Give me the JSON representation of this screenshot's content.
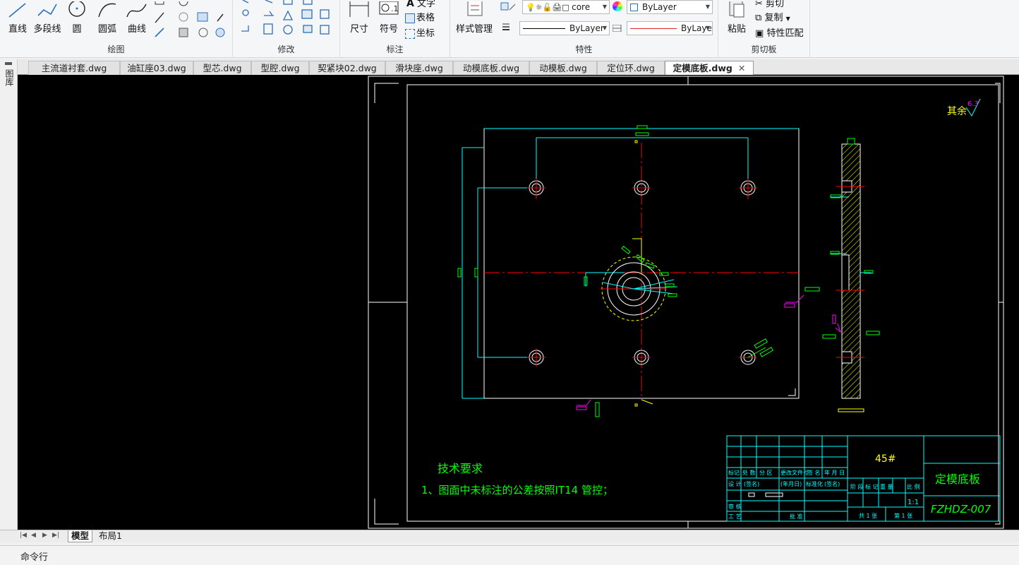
{
  "ribbon": {
    "draw": {
      "label": "绘图",
      "buttons": [
        {
          "label": "直线",
          "icon": "line-icon"
        },
        {
          "label": "多段线",
          "icon": "polyline-icon"
        },
        {
          "label": "圆",
          "icon": "circle-icon"
        },
        {
          "label": "圆弧",
          "icon": "arc-icon"
        },
        {
          "label": "曲线",
          "icon": "spline-icon"
        }
      ]
    },
    "modify": {
      "label": "修改"
    },
    "annotate": {
      "label": "标注",
      "dimension": "尺寸",
      "symbol": "符号",
      "text": "文字",
      "table": "表格",
      "coordinate": "坐标"
    },
    "properties": {
      "label": "特性",
      "style_manager": "样式管理",
      "layer_value": "core",
      "color_value": "ByLayer",
      "linetype_value": "ByLayer",
      "lineweight_value": "ByLayer"
    },
    "clipboard": {
      "label": "剪切板",
      "paste": "粘贴",
      "cut": "剪切",
      "copy": "复制",
      "match_properties": "特性匹配"
    }
  },
  "file_tabs": [
    {
      "label": "主流道衬套.dwg",
      "active": false
    },
    {
      "label": "油缸座03.dwg",
      "active": false
    },
    {
      "label": "型芯.dwg",
      "active": false
    },
    {
      "label": "型腔.dwg",
      "active": false
    },
    {
      "label": "契紧块02.dwg",
      "active": false
    },
    {
      "label": "滑块座.dwg",
      "active": false
    },
    {
      "label": "动模底板.dwg",
      "active": false
    },
    {
      "label": "动模板.dwg",
      "active": false
    },
    {
      "label": "定位环.dwg",
      "active": false
    },
    {
      "label": "定模底板.dwg",
      "active": true
    }
  ],
  "left_panel_label": "图库",
  "drawing": {
    "surface_finish_label": "其余",
    "surface_finish_value": "6.3",
    "tech_req_title": "技术要求",
    "tech_req_line1": "1、图面中未标注的公差按照IT14 管控；",
    "title_block": {
      "material": "45#",
      "part_name": "定模底板",
      "drawing_no": "FZHDZ-007",
      "scale": "1:1",
      "sheet_total": "共 1 张",
      "sheet_no": "第 1 张",
      "row_mark": "标记",
      "row_count": "处 数",
      "row_zone": "分 区",
      "row_change": "更改文件号",
      "row_sign": "签 名",
      "row_date": "年 月 日",
      "row_design": "设 计",
      "row_signname": "(签名)",
      "row_date2": "(年月日)",
      "row_standard": "标准化",
      "row_review": "审 核",
      "row_process": "工 艺",
      "row_approve": "批 准",
      "stage_mark": "阶 段 标 记",
      "weight": "重 量",
      "ratio": "比 例"
    },
    "colors": {
      "outline": "#ffffff",
      "cyan": "#00ffff",
      "green": "#00ff00",
      "yellow": "#ffff00",
      "red": "#ff0000",
      "magenta": "#ff00ff"
    }
  },
  "layout_tabs": [
    {
      "label": "模型",
      "active": true
    },
    {
      "label": "布局1",
      "active": false
    }
  ],
  "command_line": {
    "label": "命令行"
  }
}
